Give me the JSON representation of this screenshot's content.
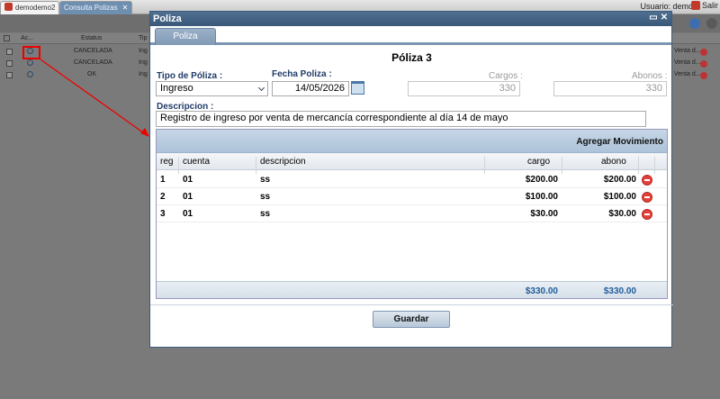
{
  "app": {
    "tab_home": "demodemo2",
    "tab_consulta": "Consulta Polizas",
    "user_label": "Usuario: demo",
    "logout_label": "Salir"
  },
  "grid": {
    "headers": {
      "ac": "Ac...",
      "estatus": "Estatus",
      "tipo": "Tip"
    },
    "rows": [
      {
        "estatus": "CANCELADA",
        "tipo": "Ing",
        "desc": "Venta d..."
      },
      {
        "estatus": "CANCELADA",
        "tipo": "Ing",
        "desc": "Venta d..."
      },
      {
        "estatus": "OK",
        "tipo": "Ing",
        "desc": "Venta d..."
      }
    ]
  },
  "modal": {
    "title": "Poliza",
    "tab_label": "Poliza",
    "heading": "Póliza 3",
    "tipo_label": "Tipo de Póliza :",
    "tipo_value": "Ingreso",
    "fecha_label": "Fecha Poliza :",
    "fecha_value": "14/05/2026",
    "cargos_label": "Cargos :",
    "cargos_value": "330",
    "abonos_label": "Abonos :",
    "abonos_value": "330",
    "descripcion_label": "Descripcion :",
    "descripcion_value": "Registro de ingreso por venta de mercancía correspondiente al  día 14 de mayo",
    "add_movement": "Agregar Movimiento",
    "save_label": "Guardar"
  },
  "movimientos": {
    "columns": {
      "reg": "reg",
      "cuenta": "cuenta",
      "descripcion": "descripcion",
      "cargo": "cargo",
      "abono": "abono"
    },
    "rows": [
      {
        "reg": "1",
        "cuenta": "01",
        "descripcion": "ss",
        "cargo": "$200.00",
        "abono": "$200.00"
      },
      {
        "reg": "2",
        "cuenta": "01",
        "descripcion": "ss",
        "cargo": "$100.00",
        "abono": "$100.00"
      },
      {
        "reg": "3",
        "cuenta": "01",
        "descripcion": "ss",
        "cargo": "$30.00",
        "abono": "$30.00"
      }
    ],
    "total_cargo": "$330.00",
    "total_abono": "$330.00"
  },
  "colors": {
    "accent": "#3a5878",
    "highlight": "#e00000",
    "delete": "#e2403a",
    "total_text": "#1f5d99"
  },
  "icons": [
    "search-icon",
    "calendar-icon",
    "remove-icon",
    "close-icon",
    "maximize-icon",
    "chevron-down-icon"
  ]
}
